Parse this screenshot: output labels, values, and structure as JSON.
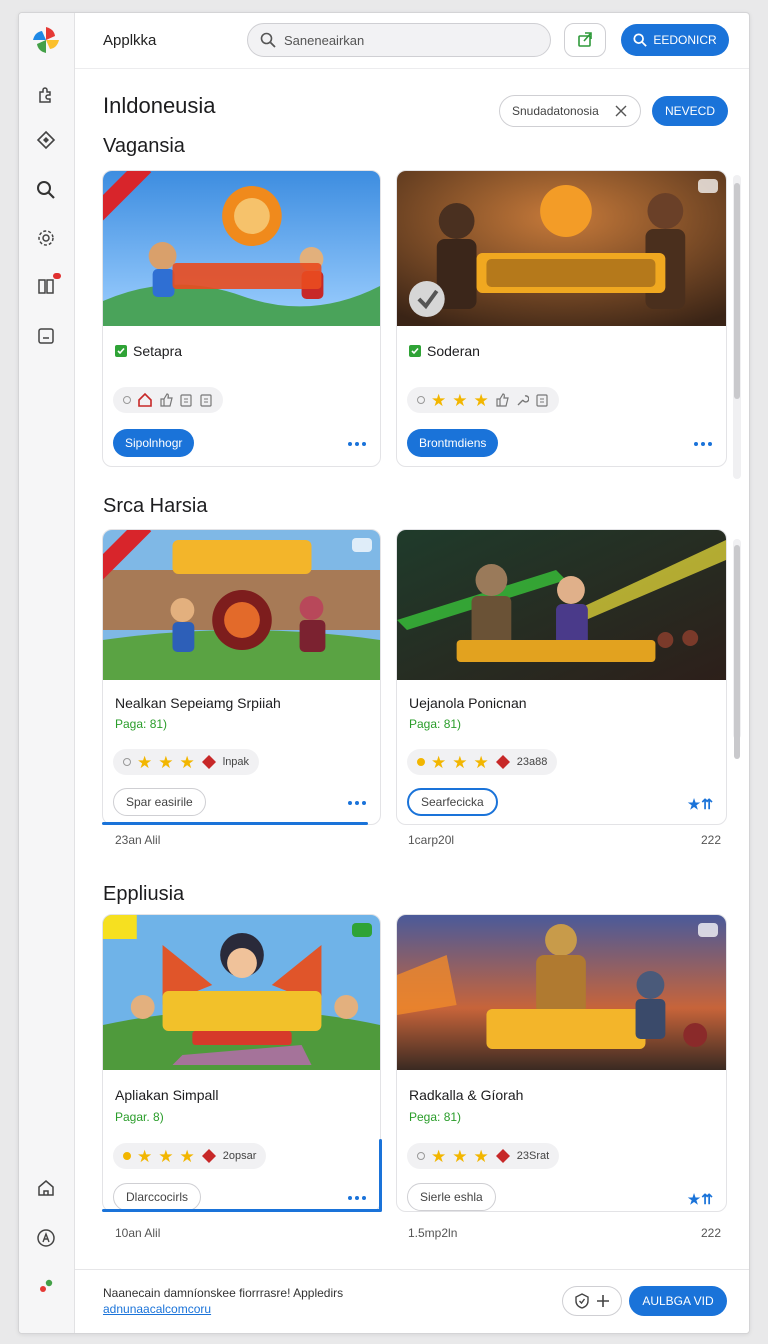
{
  "app": {
    "title": "Applkka"
  },
  "header": {
    "search_placeholder": "Saneneairkan",
    "cta_label": "EEDONICR"
  },
  "page": {
    "title": "Inldoneusia",
    "filter_chip": "Snudadatonosia",
    "action_label": "NEVECD"
  },
  "sections": [
    {
      "title": "Vagansia",
      "cards": [
        {
          "title": "Setapra",
          "button": "Sipolnhogr",
          "icons": [
            "home-icon",
            "thumb-icon",
            "clipboard-icon",
            "clipboard-icon"
          ]
        },
        {
          "title": "Soderan",
          "button": "Brontmdiens",
          "rating": 3,
          "icons": [
            "thumb-icon",
            "wrench-icon",
            "clipboard-icon"
          ]
        }
      ]
    },
    {
      "title": "Srca Harsia",
      "cards": [
        {
          "title": "Nealkan Sepeiamg Srpiiah",
          "sub": "Paga: 81)",
          "rating": 3,
          "meta": "lnpak",
          "button": "Spar easirile",
          "below": "23an Alil"
        },
        {
          "title": "Uejanola Ponicnan",
          "sub": "Paga: 81)",
          "rating": 3,
          "meta": "23a88",
          "button": "Searfecicka",
          "below": "1carp20l",
          "below_right": "222"
        }
      ]
    },
    {
      "title": "Eppliusia",
      "cards": [
        {
          "title": "Apliakan Simpall",
          "sub": "Pagar. 8)",
          "rating": 3,
          "meta": "2opsar",
          "button": "Dlarccocirls",
          "below": "10an Alil"
        },
        {
          "title": "Radkalla & Gíorah",
          "sub": "Pega: 81)",
          "rating": 3,
          "meta": "23Srat",
          "button": "Sierle eshla",
          "below": "1.5mp2ln",
          "below_right": "222"
        }
      ]
    }
  ],
  "footer": {
    "text": "Naanecain damníonskee fiorrrasre! Appledirs",
    "link": "adnunaacalcomcoru",
    "button": "AULBGA VID"
  },
  "colors": {
    "accent": "#1a73d9",
    "success": "#2a9d2a",
    "star": "#f2b600",
    "badge": "#d8252b"
  }
}
